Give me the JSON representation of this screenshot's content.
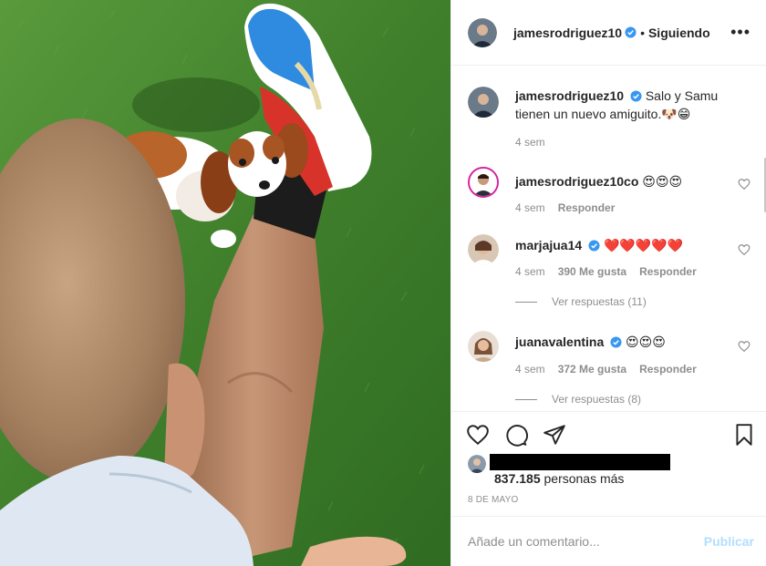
{
  "post": {
    "username": "jamesrodriguez10",
    "separator": "•",
    "follow_status": "Siguiendo",
    "more_label": "•••",
    "caption": {
      "username": "jamesrodriguez10",
      "text": "Salo y Samu tienen un nuevo amiguito.",
      "emoji": "🐶😁",
      "time": "4 sem"
    }
  },
  "comments": [
    {
      "username": "jamesrodriguez10co",
      "text": "😍😍😍",
      "time": "4 sem",
      "likes": "",
      "reply_label": "Responder",
      "verified": false,
      "view_replies": ""
    },
    {
      "username": "marjajua14",
      "text": "❤️❤️❤️❤️❤️",
      "time": "4 sem",
      "likes": "390 Me gusta",
      "reply_label": "Responder",
      "verified": true,
      "view_replies": "Ver respuestas (11)"
    },
    {
      "username": "juanavalentina",
      "text": "😍😍😍",
      "time": "4 sem",
      "likes": "372 Me gusta",
      "reply_label": "Responder",
      "verified": true,
      "view_replies": "Ver respuestas (8)"
    }
  ],
  "actions": {
    "like_icon": "heart-icon",
    "comment_icon": "comment-icon",
    "share_icon": "paper-plane-icon",
    "save_icon": "bookmark-icon"
  },
  "likes": {
    "count": "837.185",
    "suffix": " personas más"
  },
  "date": "8 DE MAYO",
  "add_comment": {
    "placeholder": "Añade un comentario...",
    "post_label": "Publicar"
  },
  "colors": {
    "text": "#262626",
    "muted": "#8e8e8e",
    "verified": "#3897f0",
    "post_disabled": "#b2dffc",
    "grass": "#3d7a2c"
  }
}
